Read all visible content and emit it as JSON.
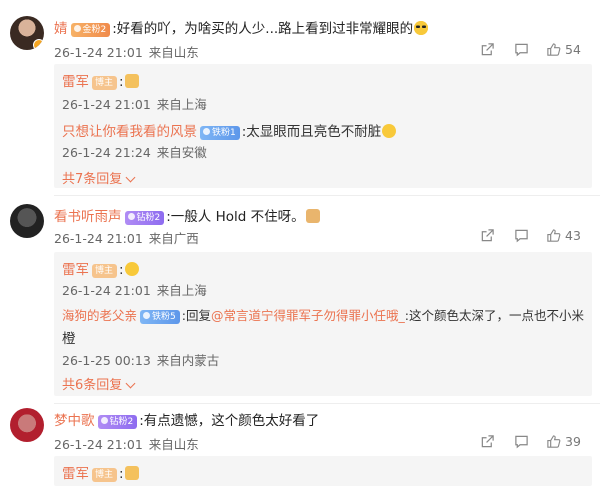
{
  "comments": [
    {
      "username": "婧",
      "badge": "金粉2",
      "text": ":好看的吖，为啥买的人少...路上看到过非常耀眼的",
      "emoji": "sunglasses-emoji",
      "date": "26-1-24 21:01",
      "location": "来自山东",
      "likes": "54",
      "replies": [
        {
          "username": "雷军",
          "badge": "博主",
          "text": ":",
          "emoji": "thumbs-up-emoji",
          "date": "26-1-24 21:01",
          "location": "来自上海"
        },
        {
          "username": "只想让你看我看的风景",
          "badge": "铁粉1",
          "text": ":太显眼而且亮色不耐脏",
          "emoji": "laughing-emoji",
          "date": "26-1-24 21:24",
          "location": "来自安徽"
        }
      ],
      "more_replies": "共7条回复"
    },
    {
      "username": "看书听雨声",
      "badge": "钻粉2",
      "text": ":一般人 Hold 不住呀。",
      "emoji": "cat-emoji",
      "date": "26-1-24 21:01",
      "location": "来自广西",
      "likes": "43",
      "replies": [
        {
          "username": "雷军",
          "badge": "博主",
          "text": ":",
          "emoji": "grin-emoji",
          "date": "26-1-24 21:01",
          "location": "来自上海"
        },
        {
          "username": "海狗的老父亲",
          "badge": "铁粉5",
          "text_prefix": ":回复",
          "mention": "@常言道宁得罪军子勿得罪小任哦_",
          "text_suffix": ":这个颜色太深了，一点也不小米",
          "text_line2": "橙",
          "date": "26-1-25 00:13",
          "location": "来自内蒙古"
        }
      ],
      "more_replies": "共6条回复"
    },
    {
      "username": "梦中歌",
      "badge": "钻粉2",
      "text": ":有点遗憾，这个颜色太好看了",
      "date": "26-1-24 21:01",
      "location": "来自山东",
      "likes": "39",
      "replies": [
        {
          "username": "雷军",
          "badge": "博主",
          "text": ":",
          "emoji": "thumbs-up-emoji"
        }
      ]
    }
  ],
  "colors": {
    "username": "#eb7350",
    "meta": "#666666",
    "reply_bg": "#f5f5f5"
  },
  "icons": [
    "share-icon",
    "comment-icon",
    "like-icon",
    "chevron-down-icon"
  ]
}
